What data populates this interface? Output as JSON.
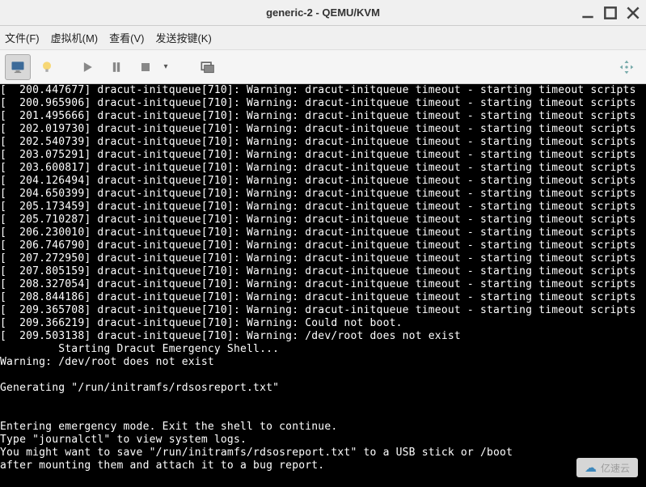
{
  "window": {
    "title": "generic-2 - QEMU/KVM"
  },
  "menus": {
    "file": "文件(F)",
    "vm": "虚拟机(M)",
    "view": "查看(V)",
    "sendkey": "发送按键(K)"
  },
  "toolbar_icons": {
    "monitor": "monitor-icon",
    "bulb": "bulb-icon",
    "play": "play-icon",
    "pause": "pause-icon",
    "stop": "stop-icon",
    "fullscreen": "fullscreen-icon",
    "move": "move-icon"
  },
  "console": {
    "lines": [
      "[  200.447677] dracut-initqueue[710]: Warning: dracut-initqueue timeout - starting timeout scripts",
      "[  200.965906] dracut-initqueue[710]: Warning: dracut-initqueue timeout - starting timeout scripts",
      "[  201.495666] dracut-initqueue[710]: Warning: dracut-initqueue timeout - starting timeout scripts",
      "[  202.019730] dracut-initqueue[710]: Warning: dracut-initqueue timeout - starting timeout scripts",
      "[  202.540739] dracut-initqueue[710]: Warning: dracut-initqueue timeout - starting timeout scripts",
      "[  203.075291] dracut-initqueue[710]: Warning: dracut-initqueue timeout - starting timeout scripts",
      "[  203.600817] dracut-initqueue[710]: Warning: dracut-initqueue timeout - starting timeout scripts",
      "[  204.126494] dracut-initqueue[710]: Warning: dracut-initqueue timeout - starting timeout scripts",
      "[  204.650399] dracut-initqueue[710]: Warning: dracut-initqueue timeout - starting timeout scripts",
      "[  205.173459] dracut-initqueue[710]: Warning: dracut-initqueue timeout - starting timeout scripts",
      "[  205.710287] dracut-initqueue[710]: Warning: dracut-initqueue timeout - starting timeout scripts",
      "[  206.230010] dracut-initqueue[710]: Warning: dracut-initqueue timeout - starting timeout scripts",
      "[  206.746790] dracut-initqueue[710]: Warning: dracut-initqueue timeout - starting timeout scripts",
      "[  207.272950] dracut-initqueue[710]: Warning: dracut-initqueue timeout - starting timeout scripts",
      "[  207.805159] dracut-initqueue[710]: Warning: dracut-initqueue timeout - starting timeout scripts",
      "[  208.327054] dracut-initqueue[710]: Warning: dracut-initqueue timeout - starting timeout scripts",
      "[  208.844186] dracut-initqueue[710]: Warning: dracut-initqueue timeout - starting timeout scripts",
      "[  209.365708] dracut-initqueue[710]: Warning: dracut-initqueue timeout - starting timeout scripts",
      "[  209.366219] dracut-initqueue[710]: Warning: Could not boot.",
      "[  209.503138] dracut-initqueue[710]: Warning: /dev/root does not exist",
      "         Starting Dracut Emergency Shell...",
      "Warning: /dev/root does not exist",
      "",
      "Generating \"/run/initramfs/rdsosreport.txt\"",
      "",
      "",
      "Entering emergency mode. Exit the shell to continue.",
      "Type \"journalctl\" to view system logs.",
      "You might want to save \"/run/initramfs/rdsosreport.txt\" to a USB stick or /boot",
      "after mounting them and attach it to a bug report.",
      ""
    ]
  },
  "watermark": {
    "text": "亿速云"
  }
}
